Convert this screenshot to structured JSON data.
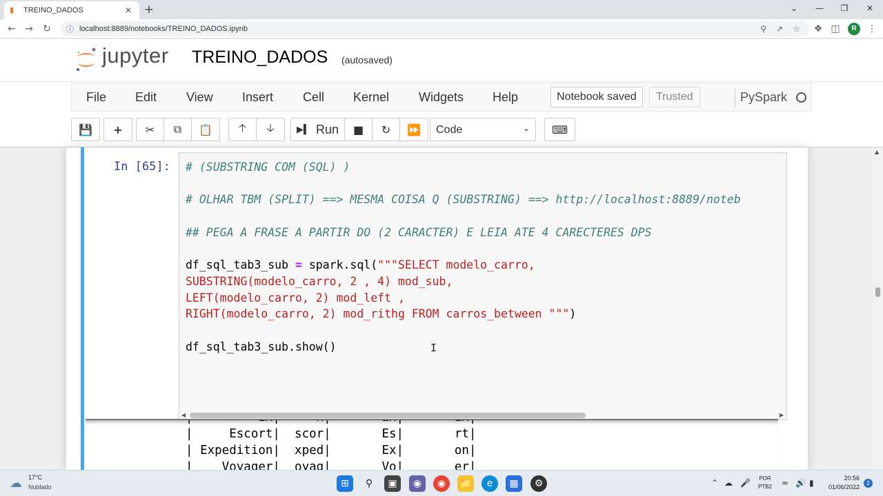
{
  "browser": {
    "tab_title": "TREINO_DADOS",
    "tab_favicon": "jupyter-favicon",
    "url": "localhost:8889/notebooks/TREINO_DADOS.ipynb",
    "avatar_letter": "R"
  },
  "jupyter": {
    "brand": "jupyter",
    "notebook_name": "TREINO_DADOS",
    "save_status": "(autosaved)",
    "menu": [
      "File",
      "Edit",
      "View",
      "Insert",
      "Cell",
      "Kernel",
      "Widgets",
      "Help"
    ],
    "notification": "Notebook saved",
    "trusted": "Trusted",
    "kernel_name": "PySpark",
    "toolbar": {
      "run_label": "Run",
      "cell_type": "Code"
    }
  },
  "cell": {
    "prompt": "In [65]:",
    "lines": [
      "# (SUBSTRING COM (SQL) )",
      "# OLHAR TBM (SPLIT) ==> MESMA COISA Q (SUBSTRING) ==> http://localhost:8889/noteb",
      "## PEGA A FRASE A PARTIR DO (2 CARACTER) E LEIA ATE 4 CARECTERES DPS",
      "df_sql_tab3_sub",
      "=",
      "spark.sql(",
      "\"\"\"SELECT modelo_carro,",
      "SUBSTRING(modelo_carro, 2 , 4) mod_sub,",
      "LEFT(modelo_carro, 2) mod_left ,",
      "RIGHT(modelo_carro, 2) mod_rithg FROM carros_between \"\"\"",
      ")",
      "df_sql_tab3_sub.show()"
    ]
  },
  "output": {
    "rows": [
      "|         Ex|     x|       Ex|       Ex|",
      "|     Escort|  scor|       Es|       rt|",
      "| Expedition|  xped|       Ex|       on|",
      "|    Voyager|  oyag|       Vo|       er|"
    ]
  },
  "taskbar": {
    "temperature": "17°C",
    "weather": "Nublado",
    "lang_top": "POR",
    "lang_bottom": "PTB2",
    "time": "20:56",
    "date": "01/06/2022",
    "notifications": "2"
  }
}
